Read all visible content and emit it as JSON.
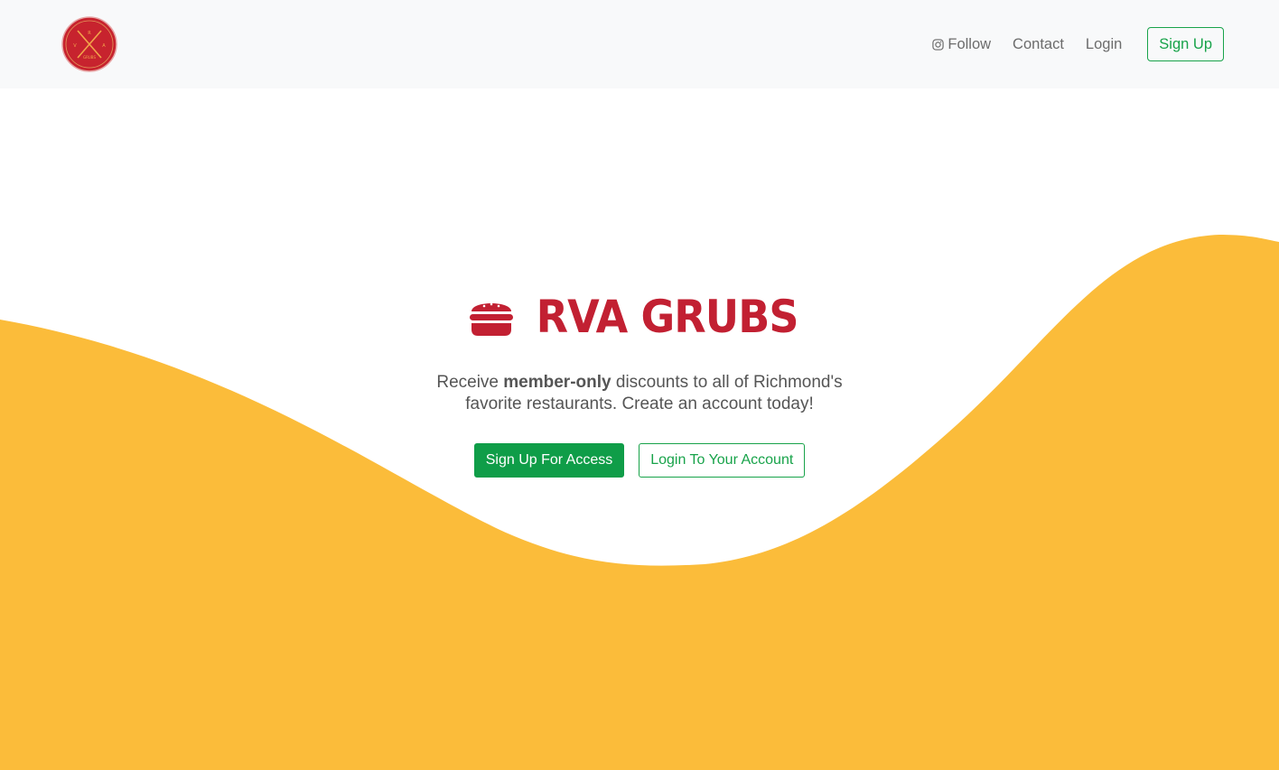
{
  "logo": {
    "top_text": "R",
    "left_text": "V",
    "right_text": "A",
    "bottom_text": "GRUBS"
  },
  "nav": {
    "follow_label": "Follow",
    "contact_label": "Contact",
    "login_label": "Login",
    "signup_label": "Sign Up"
  },
  "hero": {
    "brand": "RVA GRUBS",
    "tagline_prefix": "Receive ",
    "tagline_bold": "member-only",
    "tagline_suffix": " discounts to all of Richmond's favorite restaurants. Create an account today!",
    "primary_button": "Sign Up For Access",
    "secondary_button": "Login To Your Account"
  },
  "colors": {
    "accent_green": "#18a34a",
    "brand_red": "#c22032",
    "wave_yellow": "#fbbc3a"
  },
  "icons": [
    "instagram-icon",
    "burger-icon",
    "logo-fork-knife-icon"
  ]
}
